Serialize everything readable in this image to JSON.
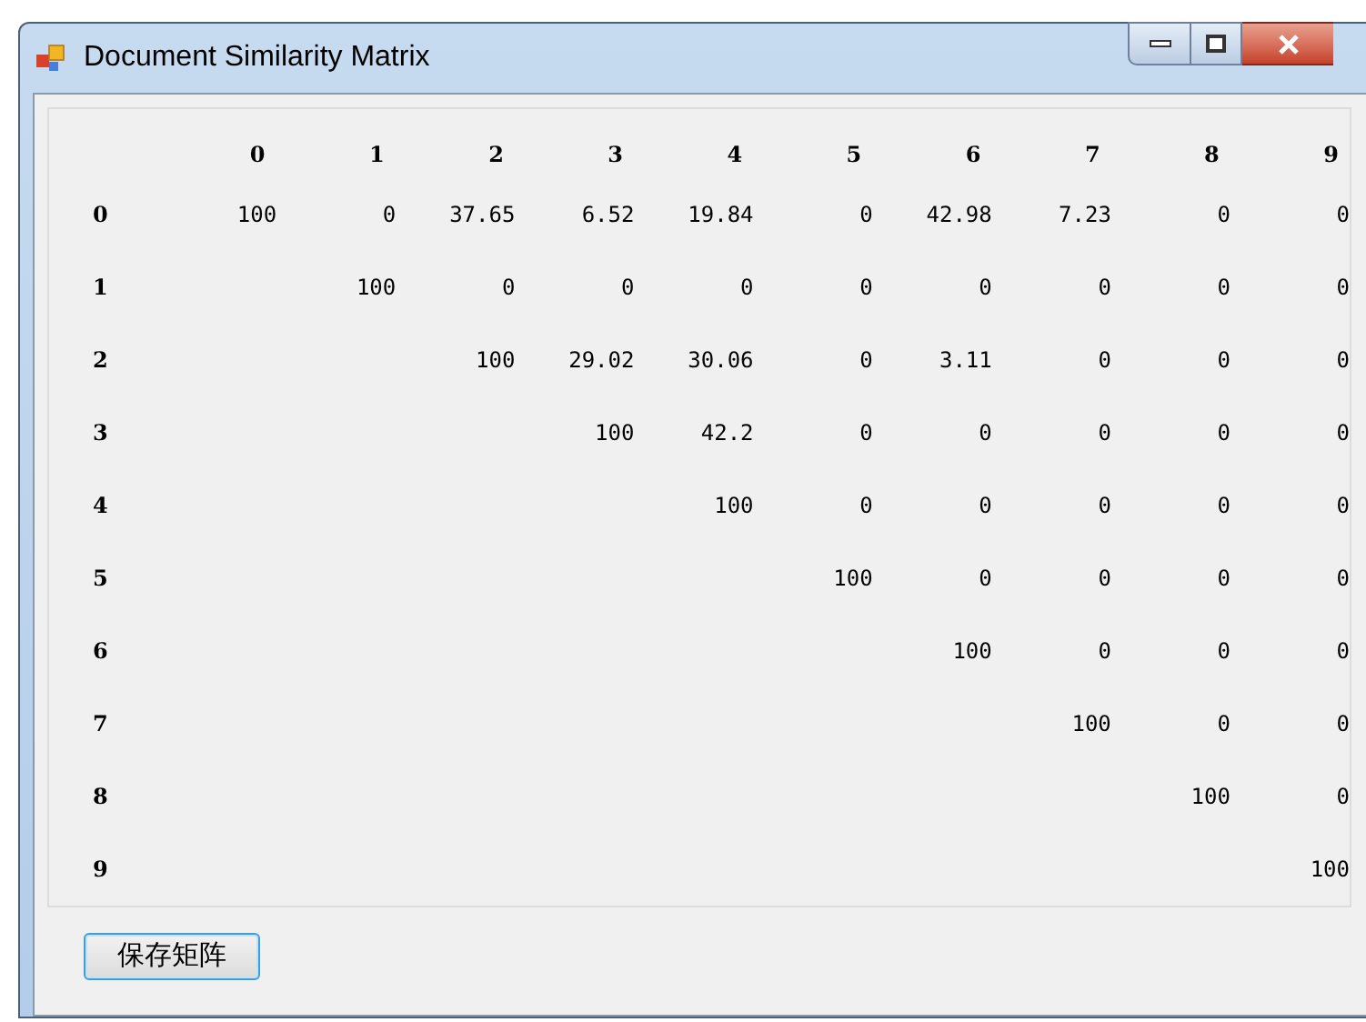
{
  "window": {
    "title": "Document Similarity Matrix"
  },
  "matrix": {
    "columns": [
      "0",
      "1",
      "2",
      "3",
      "4",
      "5",
      "6",
      "7",
      "8",
      "9"
    ],
    "rows": [
      {
        "label": "0",
        "cells": [
          "100",
          "0",
          "37.65",
          "6.52",
          "19.84",
          "0",
          "42.98",
          "7.23",
          "0",
          "0"
        ]
      },
      {
        "label": "1",
        "cells": [
          null,
          "100",
          "0",
          "0",
          "0",
          "0",
          "0",
          "0",
          "0",
          "0"
        ]
      },
      {
        "label": "2",
        "cells": [
          null,
          null,
          "100",
          "29.02",
          "30.06",
          "0",
          "3.11",
          "0",
          "0",
          "0"
        ]
      },
      {
        "label": "3",
        "cells": [
          null,
          null,
          null,
          "100",
          "42.2",
          "0",
          "0",
          "0",
          "0",
          "0"
        ]
      },
      {
        "label": "4",
        "cells": [
          null,
          null,
          null,
          null,
          "100",
          "0",
          "0",
          "0",
          "0",
          "0"
        ]
      },
      {
        "label": "5",
        "cells": [
          null,
          null,
          null,
          null,
          null,
          "100",
          "0",
          "0",
          "0",
          "0"
        ]
      },
      {
        "label": "6",
        "cells": [
          null,
          null,
          null,
          null,
          null,
          null,
          "100",
          "0",
          "0",
          "0"
        ]
      },
      {
        "label": "7",
        "cells": [
          null,
          null,
          null,
          null,
          null,
          null,
          null,
          "100",
          "0",
          "0"
        ]
      },
      {
        "label": "8",
        "cells": [
          null,
          null,
          null,
          null,
          null,
          null,
          null,
          null,
          "100",
          "0"
        ]
      },
      {
        "label": "9",
        "cells": [
          null,
          null,
          null,
          null,
          null,
          null,
          null,
          null,
          null,
          "100"
        ]
      }
    ]
  },
  "buttons": [
    {
      "label": "保存矩阵"
    }
  ]
}
